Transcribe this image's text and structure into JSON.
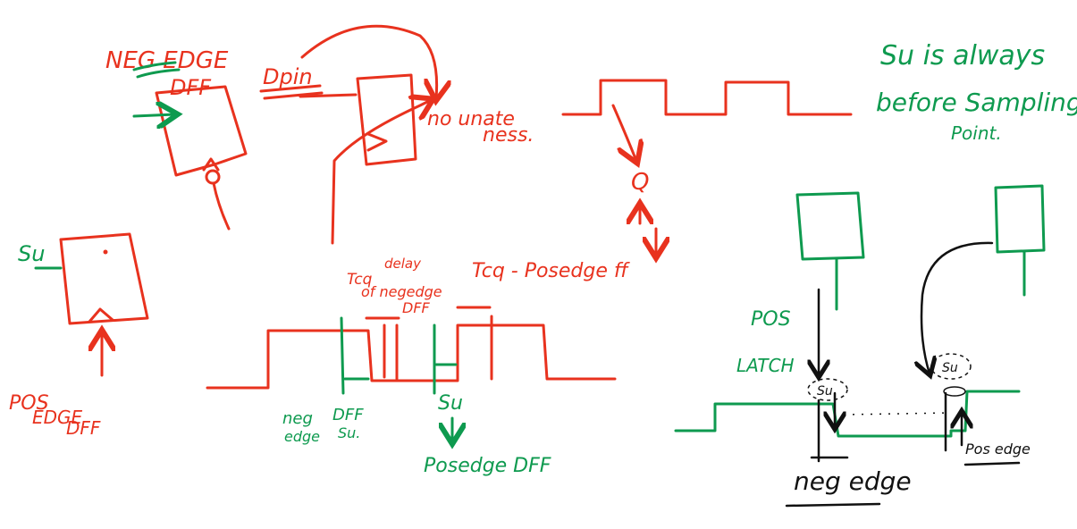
{
  "colors": {
    "red": "#e8321e",
    "green": "#0e9a4f",
    "black": "#111111",
    "background": "#ffffff"
  },
  "labels": {
    "neg_edge_dff_line1": "NEG EDGE",
    "neg_edge_dff_line2": "DFF",
    "dpin": "Dpin",
    "no_unateness_line1": "no unate",
    "no_unateness_line2": "ness.",
    "q": "Q",
    "su_left": "Su",
    "pos_edge_dff_line1": "POS",
    "pos_edge_dff_line2": "EDGE",
    "pos_edge_dff_line3": "DFF",
    "tcq_delay_line1": "Tcq",
    "tcq_delay_line2": "delay",
    "tcq_delay_line3": "of negedge",
    "tcq_delay_line4": "DFF",
    "tcq_posedge": "Tcq - Posedge ff",
    "neg_dff_su_line1": "neg",
    "neg_dff_su_line2": "edge",
    "neg_dff_su_line3": "DFF",
    "neg_dff_su_line4": "Su.",
    "su_middle": "Su",
    "posedge_dff": "Posedge DFF",
    "su_note_line1": "Su is always",
    "su_note_line2": "before Sampling",
    "su_note_line3": "Point.",
    "pos_latch_line1": "POS",
    "pos_latch_line2": "LATCH",
    "su_bubble_1": "Su",
    "su_bubble_2": "Su",
    "neg_edge": "neg edge",
    "pos_edge": "Pos edge"
  }
}
